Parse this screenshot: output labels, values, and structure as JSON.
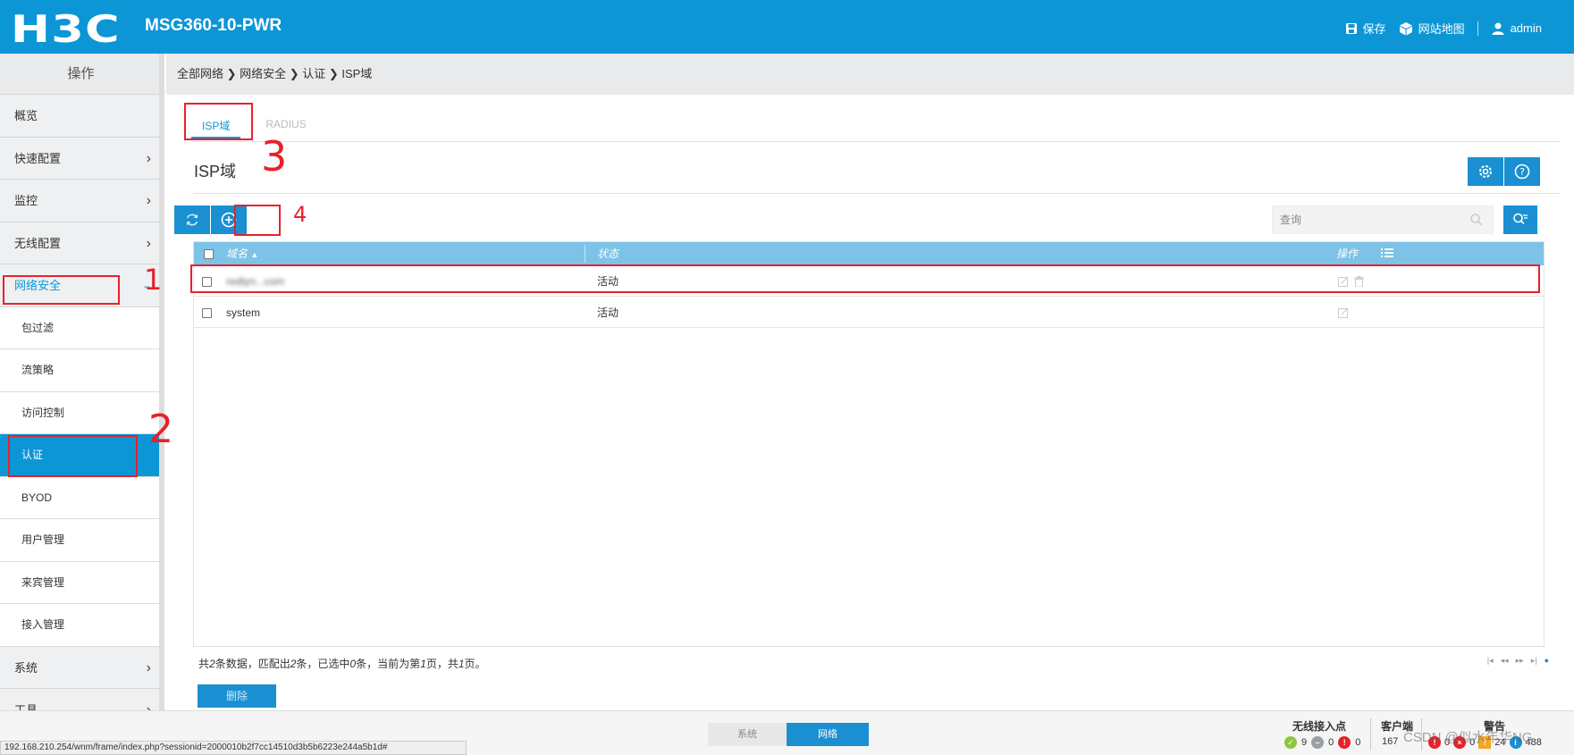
{
  "header": {
    "logo": "H3C",
    "model": "MSG360-10-PWR",
    "save_label": "保存",
    "sitemap_label": "网站地图",
    "user_label": "admin"
  },
  "sidebar": {
    "title": "操作",
    "items": [
      {
        "label": "概览"
      },
      {
        "label": "快速配置"
      },
      {
        "label": "监控"
      },
      {
        "label": "无线配置"
      },
      {
        "label": "网络安全"
      },
      {
        "label": "包过滤"
      },
      {
        "label": "流策略"
      },
      {
        "label": "访问控制"
      },
      {
        "label": "认证"
      },
      {
        "label": "BYOD"
      },
      {
        "label": "用户管理"
      },
      {
        "label": "来宾管理"
      },
      {
        "label": "接入管理"
      },
      {
        "label": "系统"
      },
      {
        "label": "工具"
      }
    ]
  },
  "breadcrumb": "全部网络 ❯ 网络安全 ❯ 认证 ❯ ISP域",
  "tabs": [
    {
      "label": "ISP域"
    },
    {
      "label": "RADIUS"
    }
  ],
  "page_title": "ISP域",
  "search": {
    "placeholder": "查询"
  },
  "table": {
    "headers": {
      "name": "域名",
      "status": "状态",
      "action": "操作"
    },
    "rows": [
      {
        "name": "redlyn...com",
        "status": "活动"
      },
      {
        "name": "system",
        "status": "活动"
      }
    ]
  },
  "pager": {
    "p1": "共",
    "total": "2",
    "p2": "条数据，匹配出",
    "matched": "2",
    "p3": "条，已选中",
    "selected": "0",
    "p4": "条，当前为第",
    "current": "1",
    "p5": "页，共",
    "pages": "1",
    "p6": "页。"
  },
  "delete_label": "删除",
  "annotations": {
    "m1": "1",
    "m2": "2",
    "m3": "3",
    "m4": "4"
  },
  "bottom": {
    "seg_system": "系统",
    "seg_network": "网络",
    "wireless_ap_label": "无线接入点",
    "ap_online": "9",
    "ap_offline": "0",
    "ap_fault": "0",
    "clients_label": "客户端",
    "clients_count": "167",
    "alerts_label": "警告",
    "alert_critical": "0",
    "alert_major": "0",
    "alert_warning": "24",
    "alert_info": "488",
    "status_url": "192.168.210.254/wnm/frame/index.php?sessionid=2000010b2f7cc14510d3b5b6223e244a5b1d#",
    "watermark": "CSDN @似水年华NG"
  },
  "colors": {
    "brand_blue": "#0c96d6",
    "table_header": "#7cc3e7",
    "annotation_red": "#e8212b"
  }
}
